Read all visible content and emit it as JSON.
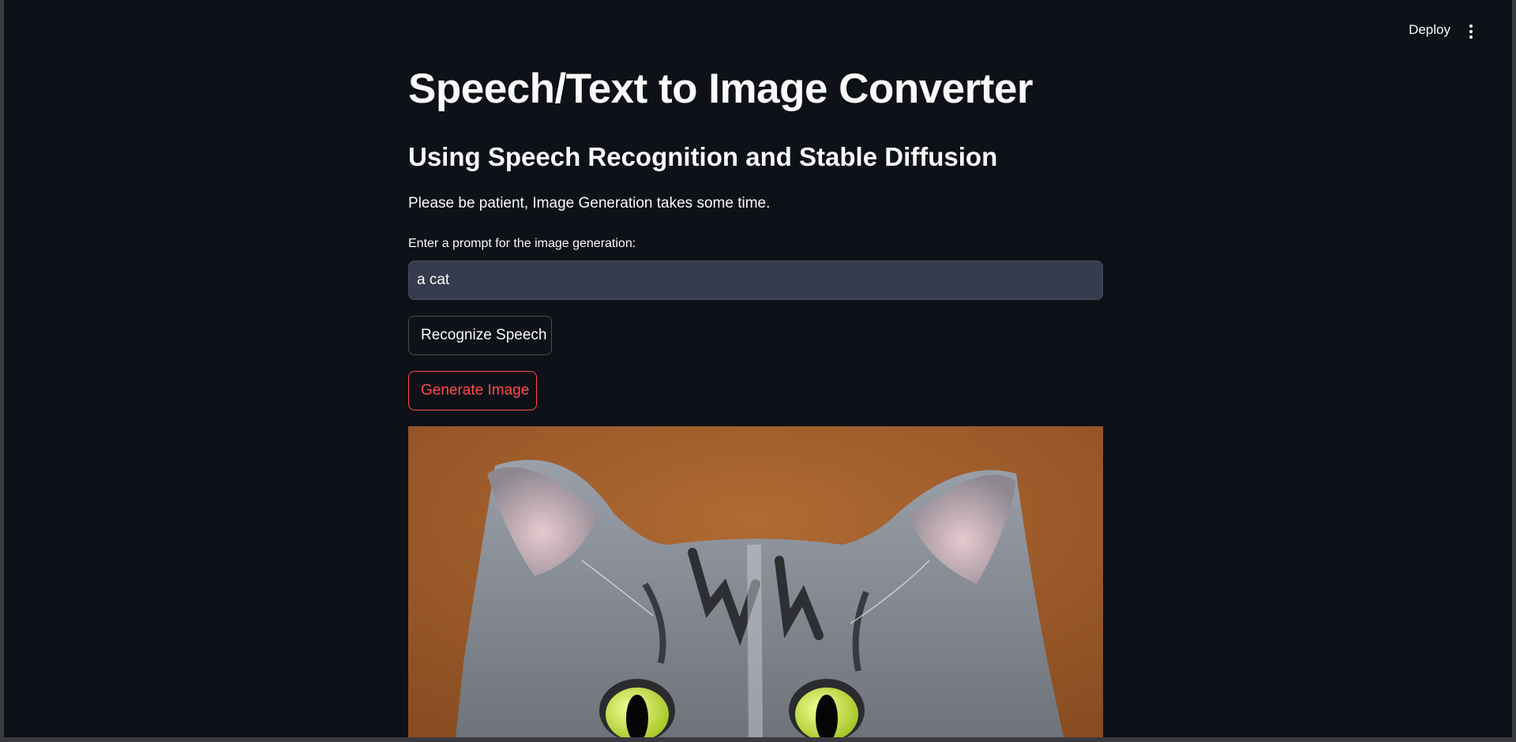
{
  "header": {
    "deploy_label": "Deploy",
    "menu_icon": "vertical-ellipsis-icon"
  },
  "main": {
    "title": "Speech/Text to Image Converter",
    "subtitle": "Using Speech Recognition and Stable Diffusion",
    "note": "Please be patient, Image Generation takes some time.",
    "prompt_label": "Enter a prompt for the image generation:",
    "prompt_value": "a cat",
    "recognize_button": "Recognize Speech",
    "generate_button": "Generate Image"
  },
  "colors": {
    "background": "#0e1117",
    "text": "#fafafa",
    "input_bg": "#363c4d",
    "primary_accent": "#ff4b4b",
    "image_bg": "#a35f2c"
  }
}
